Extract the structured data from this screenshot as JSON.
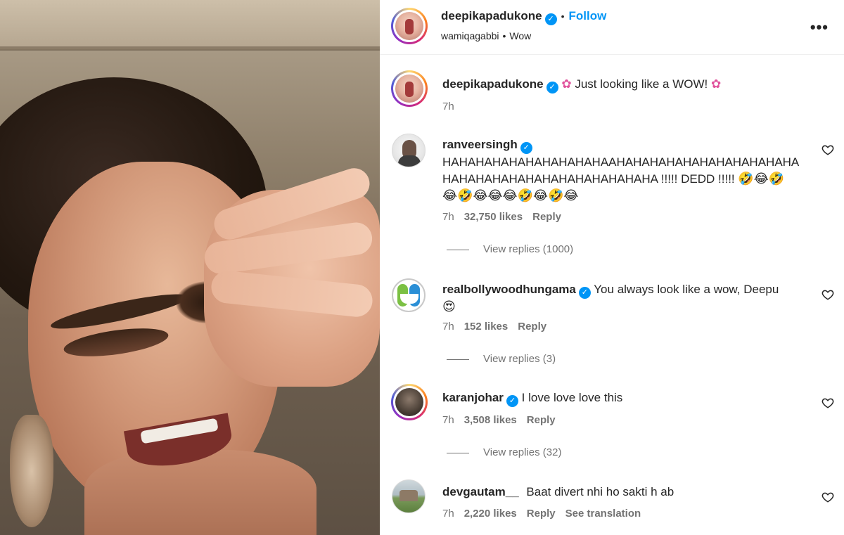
{
  "post": {
    "username": "deepikapadukone",
    "follow_label": "Follow",
    "subline_user": "wamiqagabbi",
    "subline_audio": "Wow",
    "more_label": "•••"
  },
  "caption": {
    "username": "deepikapadukone",
    "flower": "✿",
    "text": "Just looking like a WOW!",
    "time": "7h"
  },
  "comments": [
    {
      "username": "ranveersingh",
      "text": "HAHAHAHAHAHAHAHAHAHAAHAHAHAHAHAHAHAHAHAHAHA HAHAHAHAHAHAHAHAHAHAHAHAHA !!!!! DEDD !!!!!",
      "emojis_line1": "🤣😂🤣",
      "emojis_line2": "😂🤣😂😂😂🤣😂🤣😂",
      "time": "7h",
      "likes": "32,750 likes",
      "reply": "Reply",
      "view_replies": "View replies (1000)"
    },
    {
      "username": "realbollywoodhungama",
      "text": "You always look like a wow, Deepu",
      "emojis_line2": "😍",
      "time": "7h",
      "likes": "152 likes",
      "reply": "Reply",
      "view_replies": "View replies (3)"
    },
    {
      "username": "karanjohar",
      "text": "I love love love this",
      "time": "7h",
      "likes": "3,508 likes",
      "reply": "Reply",
      "view_replies": "View replies (32)"
    },
    {
      "username": "devgautam__",
      "text": "Baat divert nhi ho sakti h ab",
      "time": "7h",
      "likes": "2,220 likes",
      "reply": "Reply",
      "see_translation": "See translation"
    }
  ],
  "colors": {
    "accent": "#0095f6",
    "text": "#262626",
    "muted": "#737373"
  }
}
